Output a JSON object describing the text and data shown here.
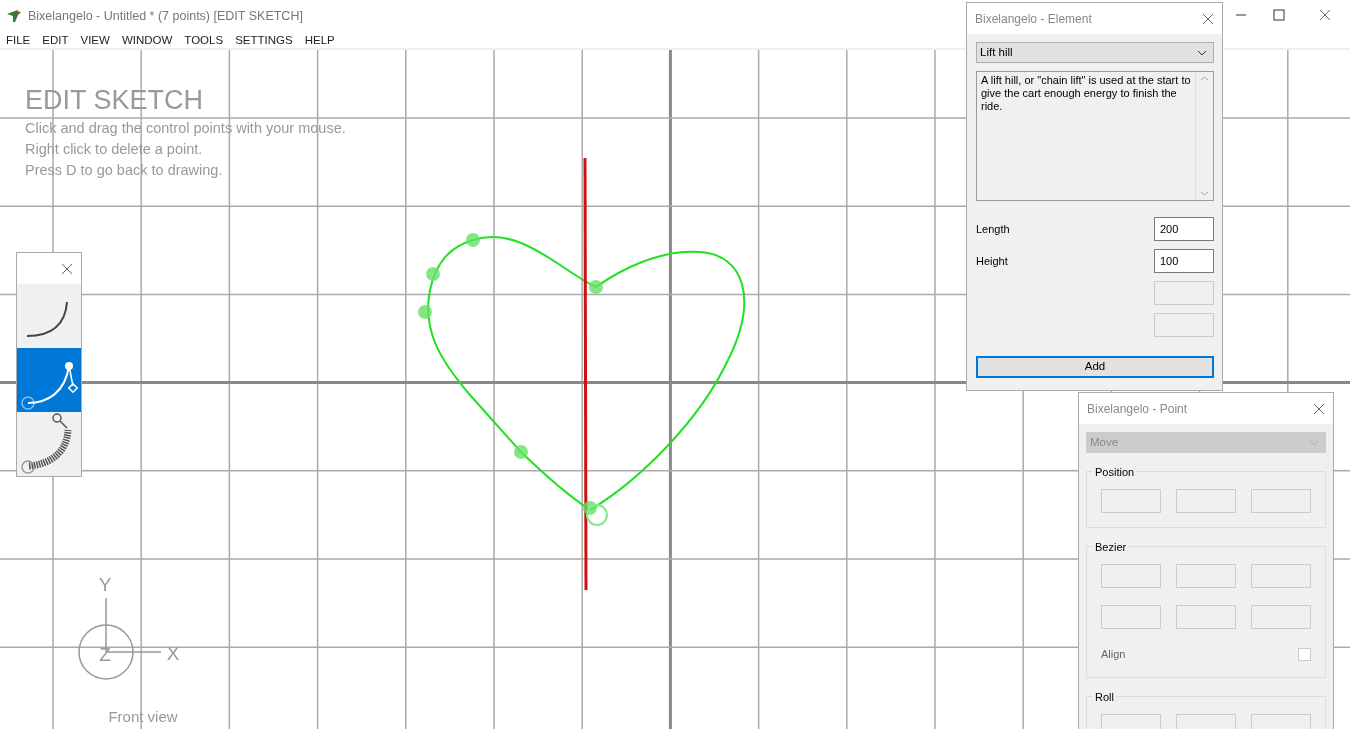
{
  "window": {
    "title": "Bixelangelo - Untitled * (7 points) [EDIT SKETCH]"
  },
  "menu": [
    "FILE",
    "EDIT",
    "VIEW",
    "WINDOW",
    "TOOLS",
    "SETTINGS",
    "HELP"
  ],
  "overlay": {
    "heading": "EDIT SKETCH",
    "lines": [
      "Click and drag the control points with your mouse.",
      "Right click to delete a point.",
      "Press D to go back to drawing."
    ]
  },
  "tools": [
    {
      "kind": "curve",
      "selected": false
    },
    {
      "kind": "bezier",
      "selected": true
    },
    {
      "kind": "track",
      "selected": false
    }
  ],
  "axis": {
    "y": "Y",
    "z": "Z",
    "x": "X",
    "view": "Front view"
  },
  "element_window": {
    "title": "Bixelangelo - Element",
    "type": "Lift hill",
    "description": "A lift hill, or \"chain lift\" is used at the start to give the cart enough energy to finish the ride.",
    "fields": [
      {
        "label": "Length",
        "value": "200",
        "disabled": false
      },
      {
        "label": "Height",
        "value": "100",
        "disabled": false
      },
      {
        "disabled": true
      },
      {
        "disabled": true
      }
    ],
    "button": "Add"
  },
  "point_window": {
    "title": "Bixelangelo - Point",
    "mode": "Move",
    "mode_disabled": true,
    "groups": [
      {
        "label": "Position",
        "fields": [
          {
            "disabled": true
          },
          {
            "disabled": true
          },
          {
            "disabled": true
          }
        ]
      },
      {
        "label": "Bezier",
        "fields": [
          {
            "disabled": true
          },
          {
            "disabled": true
          },
          {
            "disabled": true
          },
          {
            "disabled": true
          },
          {
            "disabled": true
          },
          {
            "disabled": true
          }
        ],
        "align": {
          "label": "Align",
          "checked": false
        }
      },
      {
        "label": "Roll",
        "fields": [
          {
            "disabled": true
          },
          {
            "disabled": true
          },
          {
            "disabled": true
          }
        ]
      }
    ]
  }
}
